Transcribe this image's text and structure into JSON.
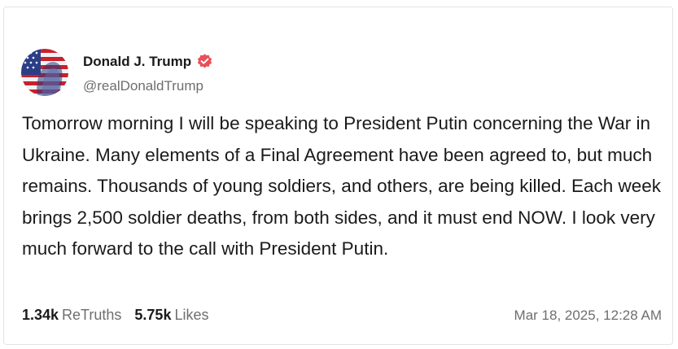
{
  "author": {
    "display_name": "Donald J. Trump",
    "handle": "@realDonaldTrump",
    "avatar_icon": "profile-photo-flag",
    "verified_icon": "verified-badge-icon"
  },
  "post": {
    "text": "Tomorrow morning I will be speaking to President Putin concerning the War in Ukraine. Many elements of a Final Agreement have been agreed to, but much remains. Thousands of young soldiers, and others, are being killed. Each week brings 2,500 soldier deaths, from both sides, and it must end NOW. I look very much forward to the call with President Putin."
  },
  "stats": {
    "retruths_count": "1.34k",
    "retruths_label": "ReTruths",
    "likes_count": "5.75k",
    "likes_label": "Likes"
  },
  "timestamp": "Mar 18, 2025, 12:28 AM",
  "colors": {
    "verified_badge": "#e8505b",
    "text_primary": "#1a1a1a",
    "text_secondary": "#6e6e6e"
  }
}
